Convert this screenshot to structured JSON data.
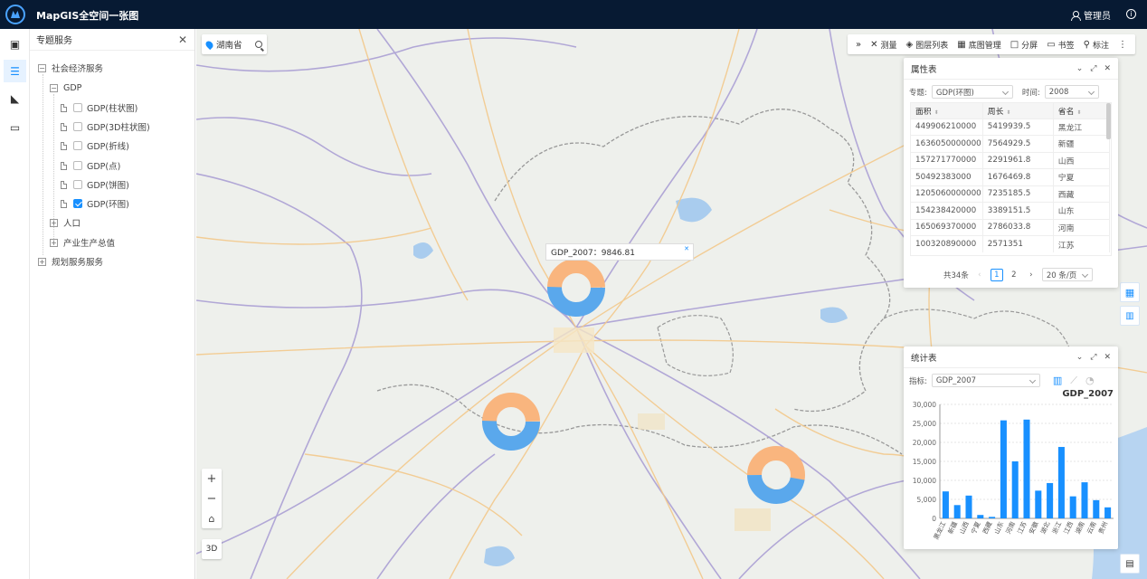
{
  "header": {
    "title": "MapGIS全空间一张图",
    "user": "管理员"
  },
  "tree": {
    "title": "专题服务",
    "groups": [
      {
        "label": "社会经济服务",
        "expanded": true
      },
      {
        "label": "规划服务服务",
        "expanded": false
      }
    ],
    "gdp": {
      "label": "GDP"
    },
    "items": [
      {
        "label": "GDP(柱状图)",
        "checked": false
      },
      {
        "label": "GDP(3D柱状图)",
        "checked": false
      },
      {
        "label": "GDP(折线)",
        "checked": false
      },
      {
        "label": "GDP(点)",
        "checked": false
      },
      {
        "label": "GDP(饼图)",
        "checked": false
      },
      {
        "label": "GDP(环图)",
        "checked": true
      }
    ],
    "population": {
      "label": "人口"
    },
    "industry": {
      "label": "产业生产总值"
    }
  },
  "map": {
    "location": "湖南省",
    "tooltip": "GDP_2007：9846.81",
    "toolbar": [
      "测量",
      "图层列表",
      "底图管理",
      "分屏",
      "书签",
      "标注"
    ],
    "btn_3d": "3D",
    "donut_colors": {
      "a": "#f9b57e",
      "b": "#5aa8ec"
    }
  },
  "attr_panel": {
    "title": "属性表",
    "theme_label": "专题:",
    "theme_value": "GDP(环图)",
    "time_label": "时间:",
    "time_value": "2008",
    "columns": [
      "面积",
      "周长",
      "省名"
    ],
    "rows": [
      [
        "449906210000",
        "5419939.5",
        "黑龙江"
      ],
      [
        "1636050000000",
        "7564929.5",
        "新疆"
      ],
      [
        "157271770000",
        "2291961.8",
        "山西"
      ],
      [
        "50492383000",
        "1676469.8",
        "宁夏"
      ],
      [
        "1205060000000",
        "7235185.5",
        "西藏"
      ],
      [
        "154238420000",
        "3389151.5",
        "山东"
      ],
      [
        "165069370000",
        "2786033.8",
        "河南"
      ],
      [
        "100320890000",
        "2571351",
        "江苏"
      ]
    ],
    "total": "共34条",
    "pages": [
      "1",
      "2"
    ],
    "page_size": "20 条/页"
  },
  "stat_panel": {
    "title": "统计表",
    "indicator_label": "指标:",
    "indicator_value": "GDP_2007"
  },
  "chart_data": {
    "type": "bar",
    "title": "GDP_2007",
    "categories": [
      "黑龙江",
      "新疆",
      "山西",
      "宁夏",
      "西藏",
      "山东",
      "河南",
      "江苏",
      "安徽",
      "湖北",
      "浙江",
      "江西",
      "湖南",
      "云南",
      "贵州"
    ],
    "values": [
      7100,
      3500,
      6000,
      900,
      400,
      25800,
      15000,
      26000,
      7300,
      9300,
      18800,
      5800,
      9500,
      4800,
      2900
    ],
    "ylim": [
      0,
      30000
    ],
    "yticks": [
      "0",
      "5,000",
      "10,000",
      "15,000",
      "20,000",
      "25,000",
      "30,000"
    ],
    "color": "#1890ff"
  }
}
